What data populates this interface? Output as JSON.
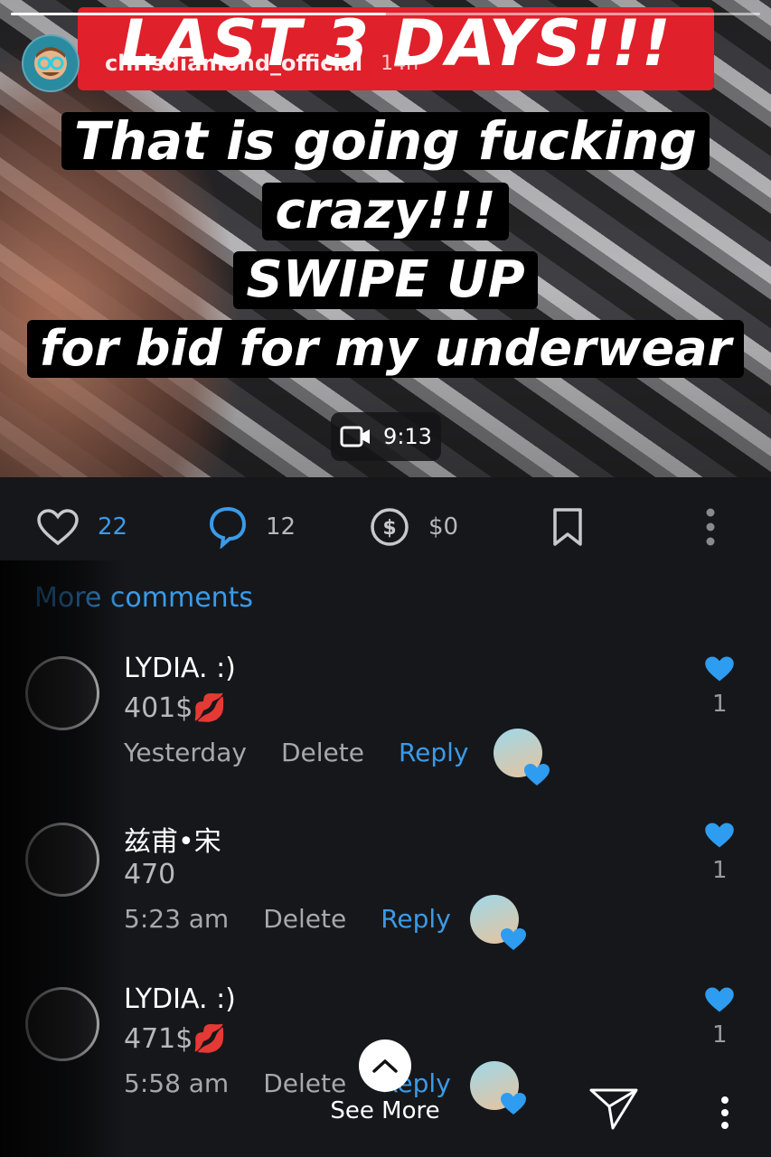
{
  "story": {
    "progress": 0.5,
    "banner": "LAST 3 DAYS!!!",
    "username": "chrisdiamond_official",
    "posted": "14h",
    "caption_lines": [
      "That is going fucking",
      "crazy!!!",
      "SWIPE UP",
      "for bid for my underwear"
    ],
    "video_duration": "9:13"
  },
  "actions": {
    "likes": "22",
    "comments": "12",
    "tips": "$0"
  },
  "comments_link": "More comments",
  "comments": [
    {
      "name": "LYDIA. :)",
      "text": "401$",
      "emoji": "💋",
      "time": "Yesterday",
      "delete": "Delete",
      "reply": "Reply",
      "likes": "1"
    },
    {
      "name": "兹甫•宋",
      "text": "470",
      "emoji": "",
      "time": "5:23 am",
      "delete": "Delete",
      "reply": "Reply",
      "likes": "1"
    },
    {
      "name": "LYDIA. :)",
      "text": "471$",
      "emoji": "💋",
      "time": "5:58 am",
      "delete": "Delete",
      "reply": "Reply",
      "likes": "1"
    }
  ],
  "see_more": "See More",
  "colors": {
    "accent": "#3a9be8",
    "banner": "#e0202a",
    "background": "#16171b"
  }
}
